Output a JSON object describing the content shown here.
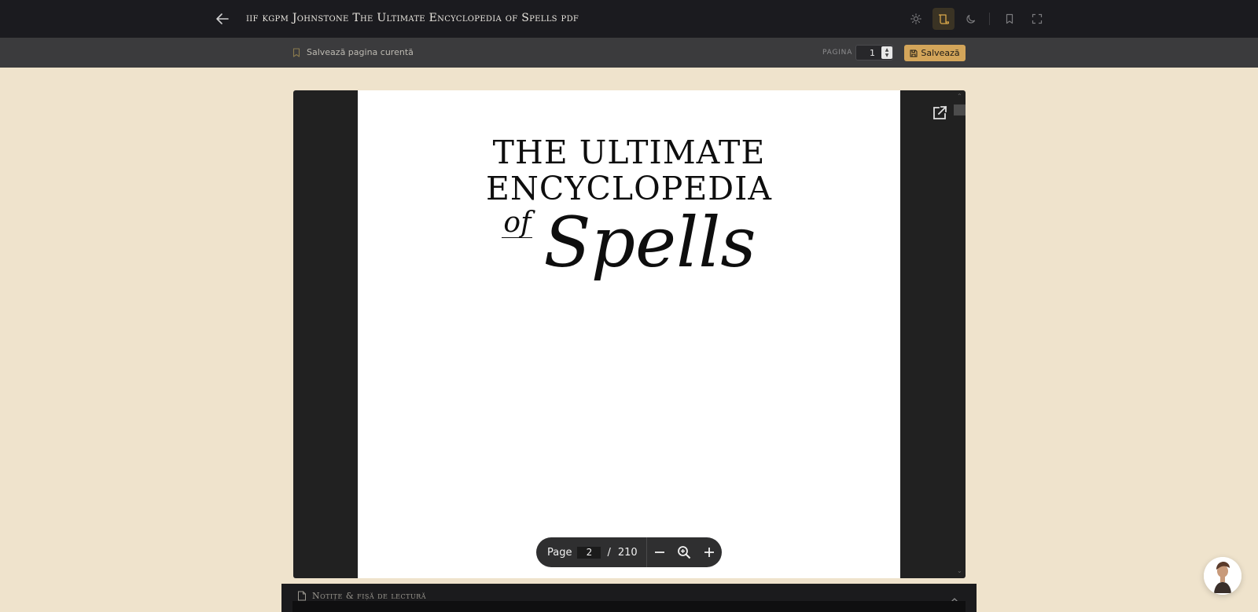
{
  "topbar": {
    "title": "iif kgpm Johnstone The Ultimate Encyclopedia of Spells pdf",
    "icons": [
      "back-arrow-icon",
      "sun-icon",
      "scroll-icon",
      "moon-icon",
      "bookmark-icon",
      "fullscreen-icon"
    ],
    "active_mode": "scroll-icon"
  },
  "subbar": {
    "save_current_label": "Salvează pagina curentă",
    "pagina_label": "PAGINA",
    "pagina_value": "1",
    "save_button_label": "Salvează"
  },
  "pdf": {
    "title_line1": "THE ULTIMATE",
    "title_line2": "ENCYCLOPEDIA",
    "of_word": "of",
    "spells_word": "Spells"
  },
  "pagebar": {
    "page_label": "Page",
    "current_page": "2",
    "slash": "/",
    "total_pages": "210"
  },
  "notes": {
    "title": "Notițe & fișă de lectură"
  },
  "colors": {
    "topbar_bg": "#1b1b1f",
    "subbar_bg": "#3b3b3d",
    "page_bg": "#efe3cc",
    "accent": "#d3a55a"
  }
}
